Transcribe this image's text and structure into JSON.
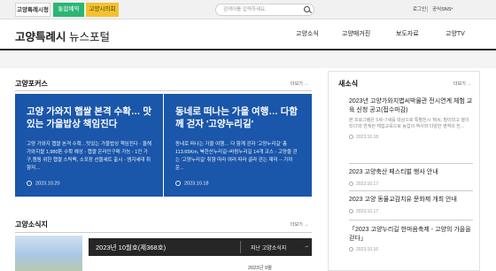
{
  "topbar": {
    "tabs": [
      "고양특례시청",
      "통합예약",
      "고양시의회"
    ],
    "search_placeholder": "검색어를 입력하세요.",
    "login": "로그인",
    "sitemap": "공식SNS",
    "sns_arrow": "⌄"
  },
  "header": {
    "logo_bold": "고양특례시",
    "logo_rest": "뉴스포털",
    "nav": [
      "고양소식",
      "고양매거진",
      "보도자료",
      "고양TV"
    ]
  },
  "focus": {
    "title": "고양포커스",
    "more": "더보기 →",
    "cards": [
      {
        "title": "고양 가와지 햅쌀 본격 수확… 맛있는 가을밥상 책임진다",
        "desc": "고양 가와지 햅쌀 본격 수확…맛있는 가을밥상 책임진다 - 올해 가와지쌀 1,980톤 수확 예상 - 햅쌀 온라인구매 가능 - 1인 가구,캠핑 위한 햅쌀 스틱팩, 소포장 선물세트 출시 - 엠지세대 취향저…",
        "date": "2023.10.20"
      },
      {
        "title": "동네로 떠나는 가을 여행… 다함께 걷자 '고양누리길'",
        "desc": "동네로 떠나는 가을 여행… 다 함께 걷자 '고양누리길' 총 113.65Km, 북한산누리길~바람누리길 14개 코스 - 고양을 걷는 '고양누리길' 취향 따라 여러 따라 골라 걷는 재미 -- 가까운…",
        "date": "2023.10.18"
      }
    ]
  },
  "news": {
    "title": "새소식",
    "more": "더보기 →",
    "items": [
      {
        "title": "2023년 고양가와지볍씨박물관 전시연계 체험 교육 신청 공고(접수마감)",
        "summary": "본 프로그램은 5세~7세를 대상으로 특별전시 '벼씨, 벌이되고 쌀이되다'와 연계된 체험교육으로 농업의 역사와 다양한 영역의 전…",
        "date": "2023.10.18"
      },
      {
        "title": "2023 고양축산 페스티벌 행사 안내",
        "summary": "",
        "date": "2023.10.17"
      },
      {
        "title": "2023 고양 동물교감치유 문화제 개최 안내",
        "summary": "",
        "date": "2023.10.17"
      },
      {
        "title": "「2023 고양누리길 한마음축제 - 고양의 가을을 걷다」",
        "summary": "",
        "date": "2023.10.16"
      }
    ]
  },
  "magazine": {
    "title": "고양소식지",
    "more": "더보기 →",
    "issue": "2023년 10월호(제368호)",
    "prev_link": "지난 고양소식지",
    "arrow": "→",
    "sub": "2023년 9월"
  }
}
